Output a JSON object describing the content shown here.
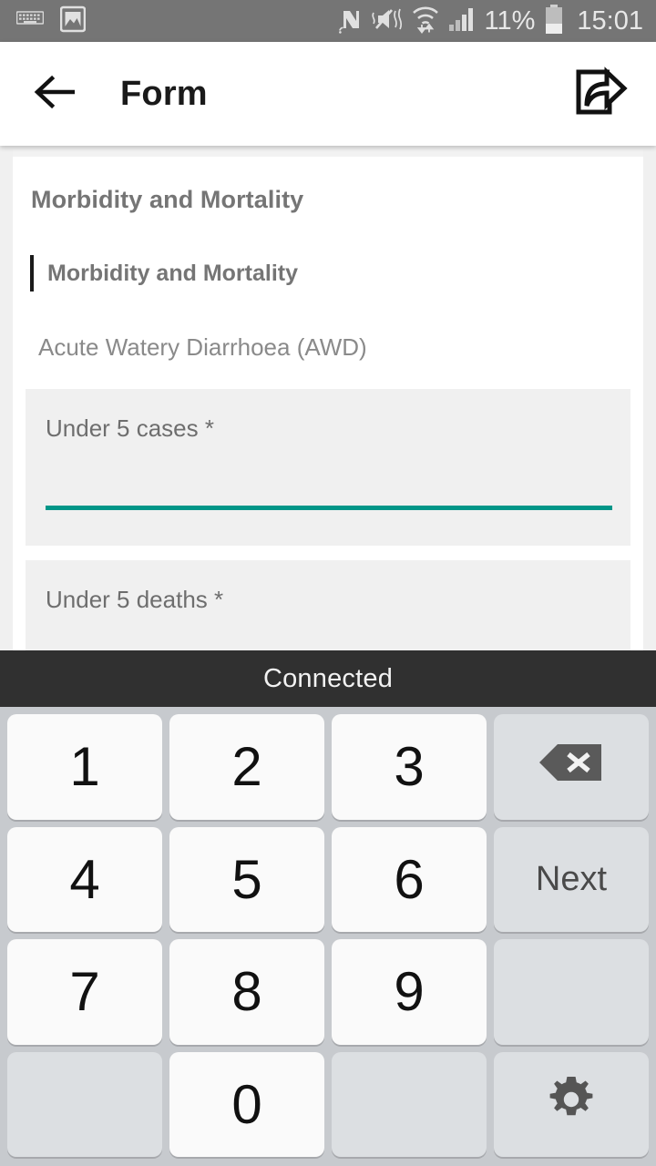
{
  "status_bar": {
    "left_icons": [
      "keyboard-icon",
      "image-icon"
    ],
    "right_icons": [
      "nfc-icon",
      "mute-vibrate-icon",
      "wifi-transfer-icon",
      "cellular-signal-icon"
    ],
    "battery_percent": "11%",
    "clock": "15:01",
    "background_color": "#757575",
    "text_color": "#e8e8e8"
  },
  "app_bar": {
    "back_icon": "back-arrow-icon",
    "title": "Form",
    "action_icon": "share-icon"
  },
  "form": {
    "section_title": "Morbidity and Mortality",
    "group_label": "Morbidity and Mortality",
    "sub_label": "Acute Watery Diarrhoea (AWD)",
    "fields": [
      {
        "label": "Under 5 cases *",
        "value": "",
        "focused": true,
        "underline_color": "#009688"
      },
      {
        "label": "Under 5 deaths *",
        "value": "",
        "focused": false,
        "underline_color": "#009688"
      }
    ]
  },
  "connection_banner": {
    "text": "Connected",
    "background_color": "#303030"
  },
  "keyboard": {
    "background_color": "#c7cace",
    "rows": [
      [
        {
          "label": "1",
          "type": "num",
          "name": "key-1"
        },
        {
          "label": "2",
          "type": "num",
          "name": "key-2"
        },
        {
          "label": "3",
          "type": "num",
          "name": "key-3"
        },
        {
          "label": "",
          "type": "func",
          "name": "key-backspace",
          "icon": "backspace-icon"
        }
      ],
      [
        {
          "label": "4",
          "type": "num",
          "name": "key-4"
        },
        {
          "label": "5",
          "type": "num",
          "name": "key-5"
        },
        {
          "label": "6",
          "type": "num",
          "name": "key-6"
        },
        {
          "label": "Next",
          "type": "func",
          "name": "key-next"
        }
      ],
      [
        {
          "label": "7",
          "type": "num",
          "name": "key-7"
        },
        {
          "label": "8",
          "type": "num",
          "name": "key-8"
        },
        {
          "label": "9",
          "type": "num",
          "name": "key-9"
        },
        {
          "label": "",
          "type": "blank",
          "name": "key-blank-right"
        }
      ],
      [
        {
          "label": "",
          "type": "blank",
          "name": "key-blank-left"
        },
        {
          "label": "0",
          "type": "num",
          "name": "key-0"
        },
        {
          "label": "",
          "type": "blank",
          "name": "key-blank-center"
        },
        {
          "label": "",
          "type": "func",
          "name": "key-settings",
          "icon": "gear-icon"
        }
      ]
    ]
  }
}
